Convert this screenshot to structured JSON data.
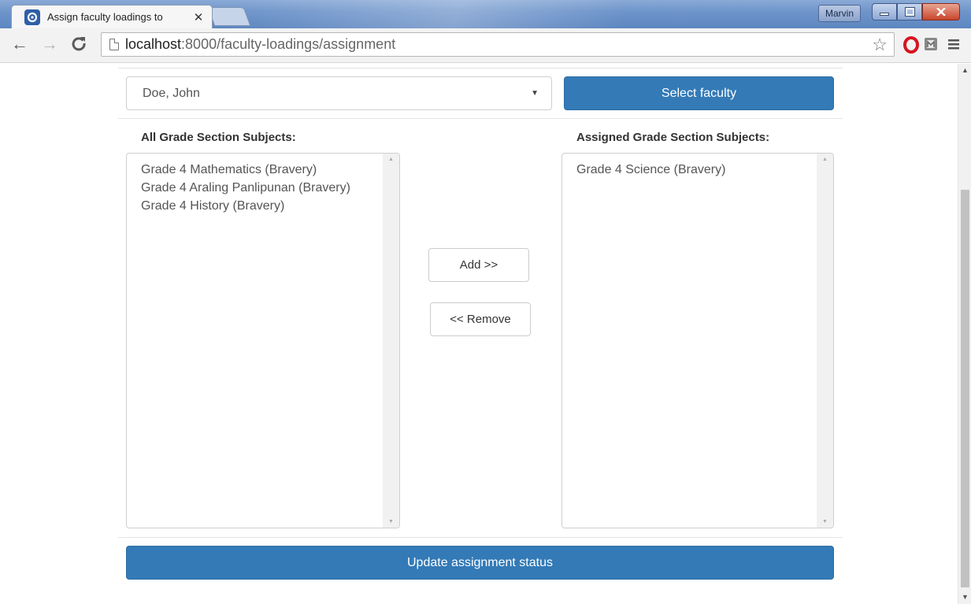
{
  "browser": {
    "tab_title": "Assign faculty loadings to",
    "tab_close": "✕",
    "profile_name": "Marvin",
    "url_host": "localhost",
    "url_path": ":8000/faculty-loadings/assignment"
  },
  "page": {
    "faculty_select": {
      "selected": "Doe, John"
    },
    "select_faculty_button": "Select faculty",
    "all_subjects": {
      "label": "All Grade Section Subjects:",
      "items": [
        "Grade 4 Mathematics (Bravery)",
        "Grade 4 Araling Panlipunan (Bravery)",
        "Grade 4 History (Bravery)"
      ]
    },
    "assigned_subjects": {
      "label": "Assigned Grade Section Subjects:",
      "items": [
        "Grade 4 Science (Bravery)"
      ]
    },
    "add_button": "Add >>",
    "remove_button": "<< Remove",
    "update_button": "Update assignment status"
  },
  "colors": {
    "primary": "#337ab7",
    "titlebar": "#6f95cb"
  }
}
